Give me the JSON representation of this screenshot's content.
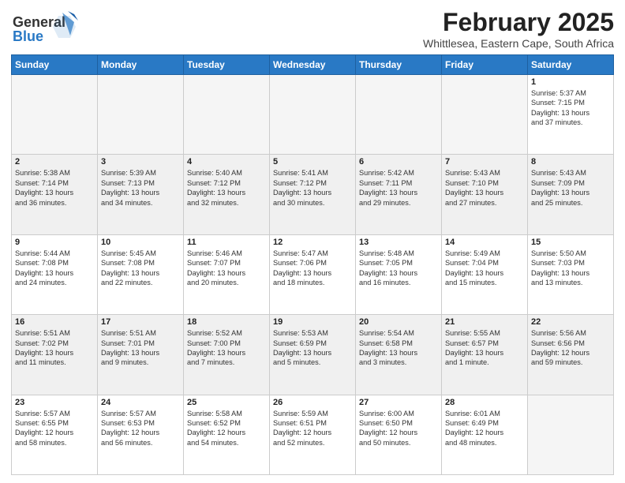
{
  "logo": {
    "text1": "General",
    "text2": "Blue"
  },
  "title": "February 2025",
  "location": "Whittlesea, Eastern Cape, South Africa",
  "weekdays": [
    "Sunday",
    "Monday",
    "Tuesday",
    "Wednesday",
    "Thursday",
    "Friday",
    "Saturday"
  ],
  "weeks": [
    [
      {
        "day": "",
        "info": ""
      },
      {
        "day": "",
        "info": ""
      },
      {
        "day": "",
        "info": ""
      },
      {
        "day": "",
        "info": ""
      },
      {
        "day": "",
        "info": ""
      },
      {
        "day": "",
        "info": ""
      },
      {
        "day": "1",
        "info": "Sunrise: 5:37 AM\nSunset: 7:15 PM\nDaylight: 13 hours\nand 37 minutes."
      }
    ],
    [
      {
        "day": "2",
        "info": "Sunrise: 5:38 AM\nSunset: 7:14 PM\nDaylight: 13 hours\nand 36 minutes."
      },
      {
        "day": "3",
        "info": "Sunrise: 5:39 AM\nSunset: 7:13 PM\nDaylight: 13 hours\nand 34 minutes."
      },
      {
        "day": "4",
        "info": "Sunrise: 5:40 AM\nSunset: 7:12 PM\nDaylight: 13 hours\nand 32 minutes."
      },
      {
        "day": "5",
        "info": "Sunrise: 5:41 AM\nSunset: 7:12 PM\nDaylight: 13 hours\nand 30 minutes."
      },
      {
        "day": "6",
        "info": "Sunrise: 5:42 AM\nSunset: 7:11 PM\nDaylight: 13 hours\nand 29 minutes."
      },
      {
        "day": "7",
        "info": "Sunrise: 5:43 AM\nSunset: 7:10 PM\nDaylight: 13 hours\nand 27 minutes."
      },
      {
        "day": "8",
        "info": "Sunrise: 5:43 AM\nSunset: 7:09 PM\nDaylight: 13 hours\nand 25 minutes."
      }
    ],
    [
      {
        "day": "9",
        "info": "Sunrise: 5:44 AM\nSunset: 7:08 PM\nDaylight: 13 hours\nand 24 minutes."
      },
      {
        "day": "10",
        "info": "Sunrise: 5:45 AM\nSunset: 7:08 PM\nDaylight: 13 hours\nand 22 minutes."
      },
      {
        "day": "11",
        "info": "Sunrise: 5:46 AM\nSunset: 7:07 PM\nDaylight: 13 hours\nand 20 minutes."
      },
      {
        "day": "12",
        "info": "Sunrise: 5:47 AM\nSunset: 7:06 PM\nDaylight: 13 hours\nand 18 minutes."
      },
      {
        "day": "13",
        "info": "Sunrise: 5:48 AM\nSunset: 7:05 PM\nDaylight: 13 hours\nand 16 minutes."
      },
      {
        "day": "14",
        "info": "Sunrise: 5:49 AM\nSunset: 7:04 PM\nDaylight: 13 hours\nand 15 minutes."
      },
      {
        "day": "15",
        "info": "Sunrise: 5:50 AM\nSunset: 7:03 PM\nDaylight: 13 hours\nand 13 minutes."
      }
    ],
    [
      {
        "day": "16",
        "info": "Sunrise: 5:51 AM\nSunset: 7:02 PM\nDaylight: 13 hours\nand 11 minutes."
      },
      {
        "day": "17",
        "info": "Sunrise: 5:51 AM\nSunset: 7:01 PM\nDaylight: 13 hours\nand 9 minutes."
      },
      {
        "day": "18",
        "info": "Sunrise: 5:52 AM\nSunset: 7:00 PM\nDaylight: 13 hours\nand 7 minutes."
      },
      {
        "day": "19",
        "info": "Sunrise: 5:53 AM\nSunset: 6:59 PM\nDaylight: 13 hours\nand 5 minutes."
      },
      {
        "day": "20",
        "info": "Sunrise: 5:54 AM\nSunset: 6:58 PM\nDaylight: 13 hours\nand 3 minutes."
      },
      {
        "day": "21",
        "info": "Sunrise: 5:55 AM\nSunset: 6:57 PM\nDaylight: 13 hours\nand 1 minute."
      },
      {
        "day": "22",
        "info": "Sunrise: 5:56 AM\nSunset: 6:56 PM\nDaylight: 12 hours\nand 59 minutes."
      }
    ],
    [
      {
        "day": "23",
        "info": "Sunrise: 5:57 AM\nSunset: 6:55 PM\nDaylight: 12 hours\nand 58 minutes."
      },
      {
        "day": "24",
        "info": "Sunrise: 5:57 AM\nSunset: 6:53 PM\nDaylight: 12 hours\nand 56 minutes."
      },
      {
        "day": "25",
        "info": "Sunrise: 5:58 AM\nSunset: 6:52 PM\nDaylight: 12 hours\nand 54 minutes."
      },
      {
        "day": "26",
        "info": "Sunrise: 5:59 AM\nSunset: 6:51 PM\nDaylight: 12 hours\nand 52 minutes."
      },
      {
        "day": "27",
        "info": "Sunrise: 6:00 AM\nSunset: 6:50 PM\nDaylight: 12 hours\nand 50 minutes."
      },
      {
        "day": "28",
        "info": "Sunrise: 6:01 AM\nSunset: 6:49 PM\nDaylight: 12 hours\nand 48 minutes."
      },
      {
        "day": "",
        "info": ""
      }
    ]
  ]
}
